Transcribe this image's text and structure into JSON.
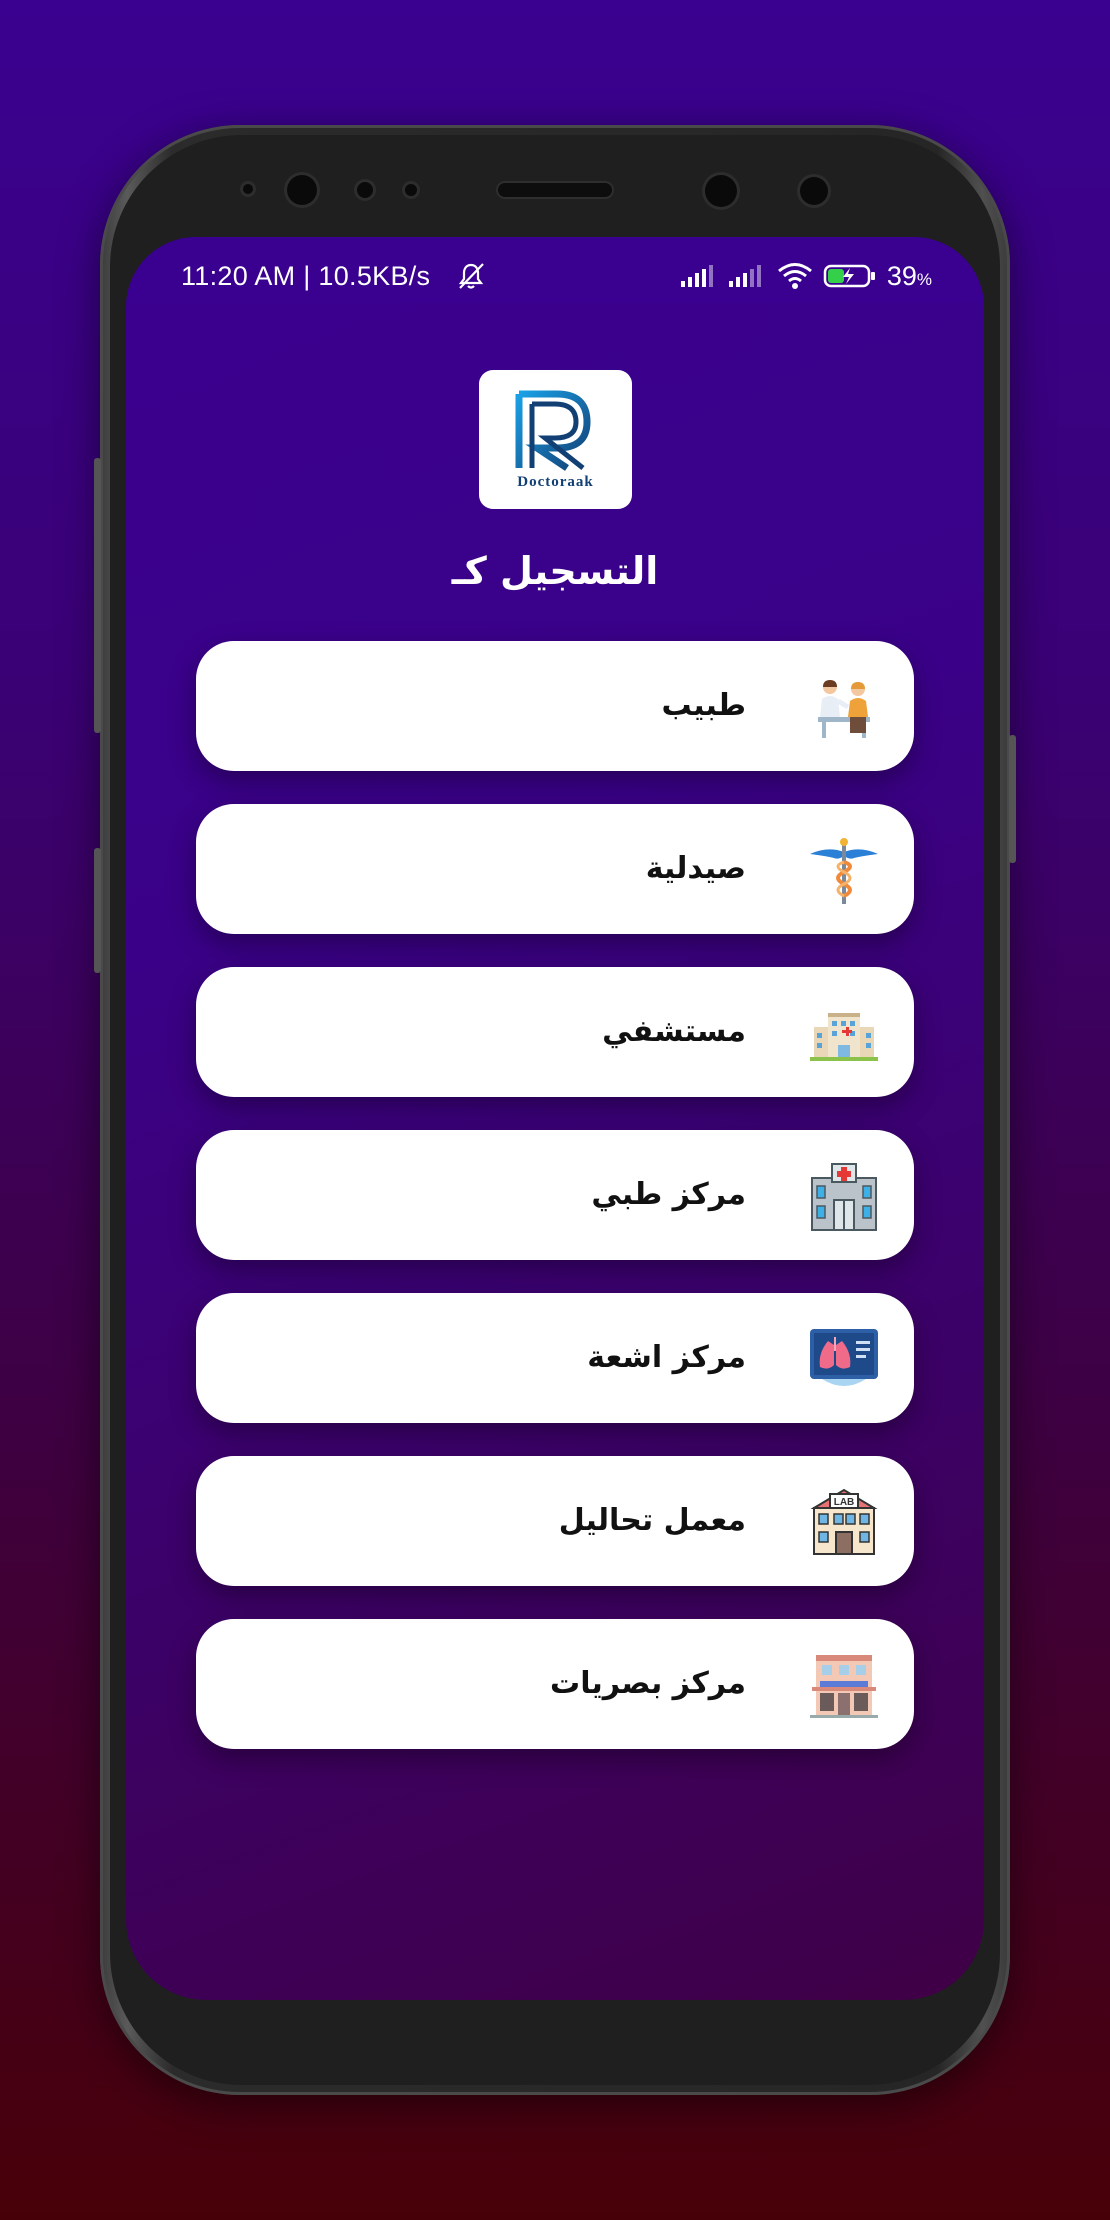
{
  "status_bar": {
    "time_speed": "11:20 AM | 10.5KB/s",
    "battery_percent": "39",
    "battery_unit": "%"
  },
  "logo": {
    "wordmark": "Doctoraak",
    "monogram": "R"
  },
  "title": "التسجيل كـ",
  "roles": [
    {
      "label": "طبيب",
      "icon": "doctor-consultation-icon"
    },
    {
      "label": "صيدلية",
      "icon": "caduceus-icon"
    },
    {
      "label": "مستشفي",
      "icon": "hospital-building-icon"
    },
    {
      "label": "مركز طبي",
      "icon": "medical-center-icon"
    },
    {
      "label": "مركز اشعة",
      "icon": "xray-lungs-icon"
    },
    {
      "label": "معمل تحاليل",
      "icon": "lab-building-icon"
    },
    {
      "label": "مركز بصريات",
      "icon": "optics-shop-icon"
    }
  ],
  "colors": {
    "background_top": "#3a0190",
    "background_bottom": "#480008",
    "card": "#ffffff",
    "logo_blue": "#123f74"
  }
}
